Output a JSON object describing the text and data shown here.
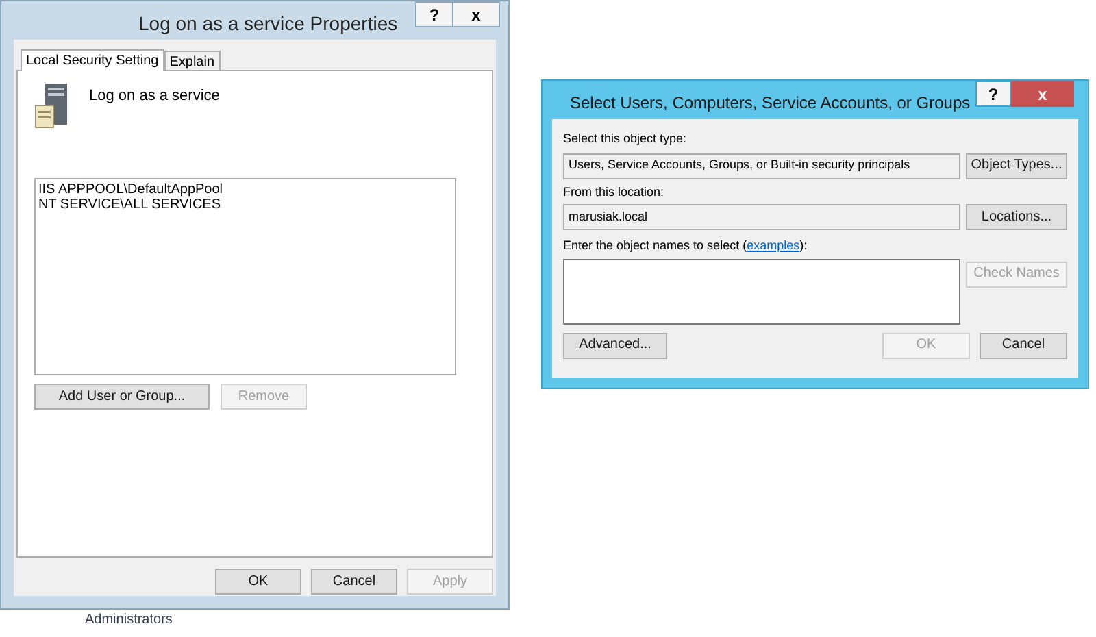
{
  "background": {
    "text": "Administrators"
  },
  "properties_window": {
    "title": "Log on as a service Properties",
    "help_button": "?",
    "close_button": "x",
    "tabs": [
      {
        "label": "Local Security Setting",
        "selected": true
      },
      {
        "label": "Explain",
        "selected": false
      }
    ],
    "policy_name": "Log on as a service",
    "members": [
      "IIS APPPOOL\\DefaultAppPool",
      "NT SERVICE\\ALL SERVICES"
    ],
    "buttons": [
      {
        "label": "Add User or Group...",
        "disabled": false
      },
      {
        "label": "Remove",
        "disabled": true
      }
    ],
    "footer_buttons": [
      {
        "label": "OK",
        "disabled": false
      },
      {
        "label": "Cancel",
        "disabled": false
      },
      {
        "label": "Apply",
        "disabled": true
      }
    ]
  },
  "select_dialog": {
    "title": "Select Users, Computers, Service Accounts, or Groups",
    "help_button": "?",
    "close_button": "x",
    "object_type_label": "Select this object type:",
    "object_type_value": "Users, Service Accounts, Groups, or Built-in security principals",
    "object_types_button": {
      "label": "Object Types...",
      "disabled": false
    },
    "location_label": "From this location:",
    "location_value": "marusiak.local",
    "locations_button": {
      "label": "Locations...",
      "disabled": false
    },
    "names_label": {
      "text_before": "Enter the object names to select (",
      "link": "examples",
      "text_after": "):"
    },
    "check_names_button": {
      "label": "Check Names",
      "disabled": true
    },
    "advanced_button": {
      "label": "Advanced...",
      "disabled": false
    },
    "footer_buttons": [
      {
        "label": "OK",
        "disabled": true
      },
      {
        "label": "Cancel",
        "disabled": false
      }
    ]
  }
}
